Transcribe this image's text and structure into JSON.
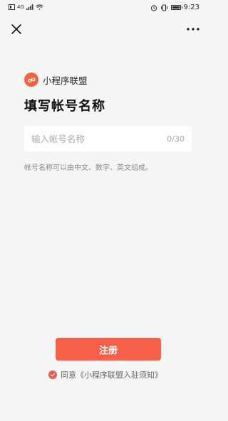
{
  "status_bar": {
    "time": "9:23",
    "network": "4G",
    "icons": [
      "hd-icon",
      "signal-icon",
      "wifi-icon",
      "alarm-icon",
      "vibrate-icon",
      "battery-icon"
    ]
  },
  "nav": {
    "close_icon": "close-icon",
    "more_icon": "more-icon"
  },
  "brand": {
    "name": "小程序联盟",
    "logo_color": "#f06444"
  },
  "page_title": "填写帐号名称",
  "account_name": {
    "value": "",
    "placeholder": "输入帐号名称",
    "counter": "0/30"
  },
  "hint": "帐号名称可以由中文、数字、英文组成。",
  "register_button": {
    "label": "注册",
    "color": "#f76048"
  },
  "agreement": {
    "checked": true,
    "text": "同意《小程序联盟入驻须知》",
    "check_color": "#e85a4a"
  }
}
